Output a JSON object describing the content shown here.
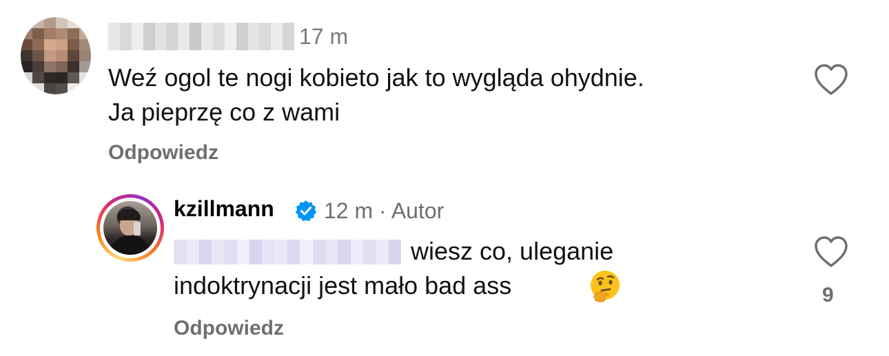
{
  "comments": [
    {
      "author": "",
      "time": "17 m",
      "text_line1": "Weź ogol te nogi kobieto jak to wygląda ohydnie.",
      "text_line2": "Ja pieprzę co z wami",
      "reply_label": "Odpowiedz",
      "like_icon": "heart-outline-icon"
    },
    {
      "author": "kzillmann",
      "verified_icon": "verified-badge-icon",
      "time": "12 m",
      "separator": "·",
      "author_tag": "Autor",
      "mention": "",
      "text_line1": "wiesz co, uleganie",
      "text_line2": "indoktrynacji jest mało bad ass",
      "emoji": "thinking-face-emoji",
      "reply_label": "Odpowiedz",
      "like_icon": "heart-outline-icon",
      "like_count": "9"
    }
  ],
  "colors": {
    "verified_blue": "#0095f6",
    "secondary_text": "#6e6e73",
    "story_ring_start": "#feda75",
    "story_ring_mid": "#d62976"
  }
}
